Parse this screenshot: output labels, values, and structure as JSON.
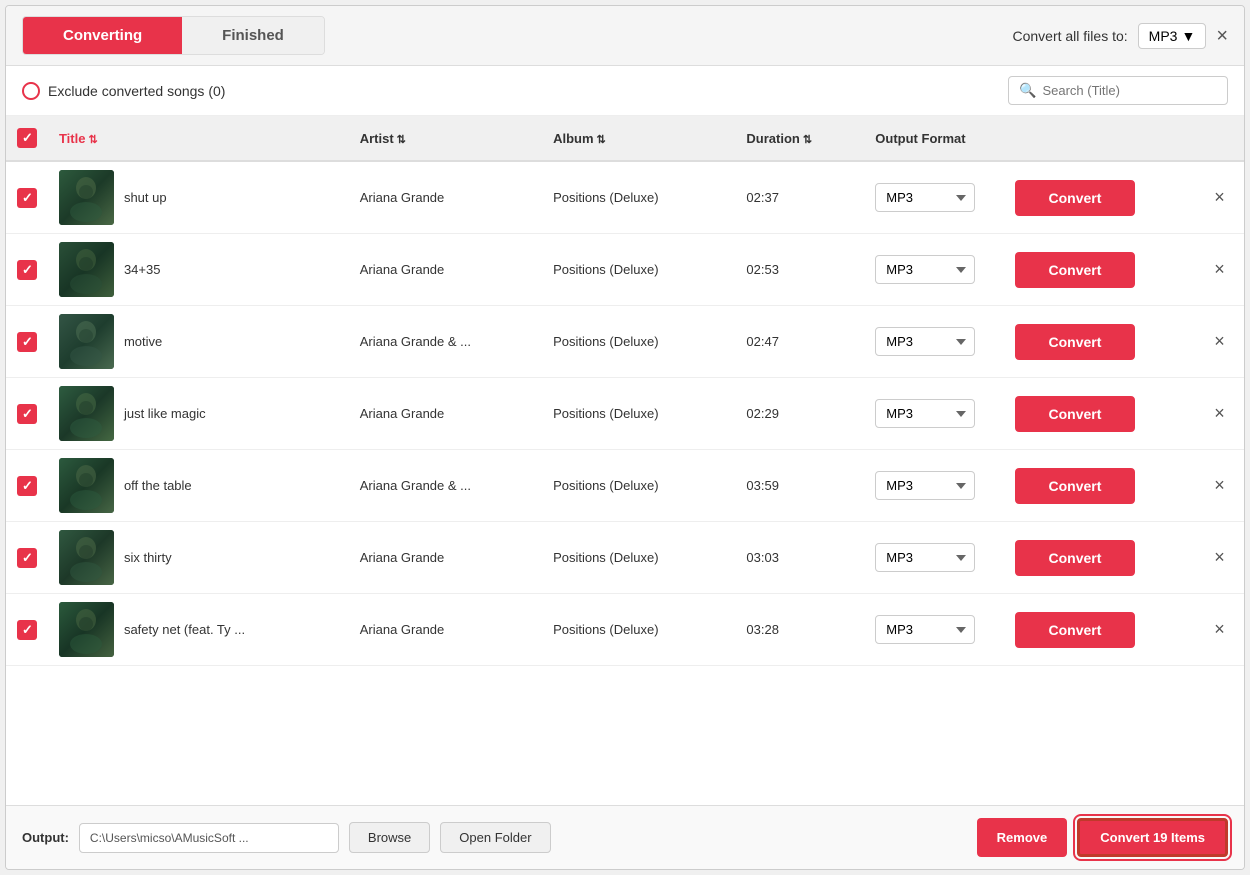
{
  "header": {
    "tab_converting": "Converting",
    "tab_finished": "Finished",
    "convert_all_label": "Convert all files to:",
    "format_value": "MP3",
    "close_label": "×"
  },
  "toolbar": {
    "exclude_label": "Exclude converted songs (0)",
    "search_placeholder": "Search (Title)"
  },
  "table": {
    "col_title": "Title",
    "col_artist": "Artist",
    "col_album": "Album",
    "col_duration": "Duration",
    "col_output_format": "Output Format",
    "rows": [
      {
        "title": "shut up",
        "artist": "Ariana Grande",
        "album": "Positions (Deluxe)",
        "duration": "02:37",
        "format": "MP3"
      },
      {
        "title": "34+35",
        "artist": "Ariana Grande",
        "album": "Positions (Deluxe)",
        "duration": "02:53",
        "format": "MP3"
      },
      {
        "title": "motive",
        "artist": "Ariana Grande & ...",
        "album": "Positions (Deluxe)",
        "duration": "02:47",
        "format": "MP3"
      },
      {
        "title": "just like magic",
        "artist": "Ariana Grande",
        "album": "Positions (Deluxe)",
        "duration": "02:29",
        "format": "MP3"
      },
      {
        "title": "off the table",
        "artist": "Ariana Grande & ...",
        "album": "Positions (Deluxe)",
        "duration": "03:59",
        "format": "MP3"
      },
      {
        "title": "six thirty",
        "artist": "Ariana Grande",
        "album": "Positions (Deluxe)",
        "duration": "03:03",
        "format": "MP3"
      },
      {
        "title": "safety net (feat. Ty ...",
        "artist": "Ariana Grande",
        "album": "Positions (Deluxe)",
        "duration": "03:28",
        "format": "MP3"
      }
    ],
    "convert_btn_label": "Convert"
  },
  "footer": {
    "output_label": "Output:",
    "output_path": "C:\\Users\\micso\\AMusicSoft ...",
    "browse_label": "Browse",
    "open_folder_label": "Open Folder",
    "remove_label": "Remove",
    "convert_all_label": "Convert 19 Items"
  }
}
